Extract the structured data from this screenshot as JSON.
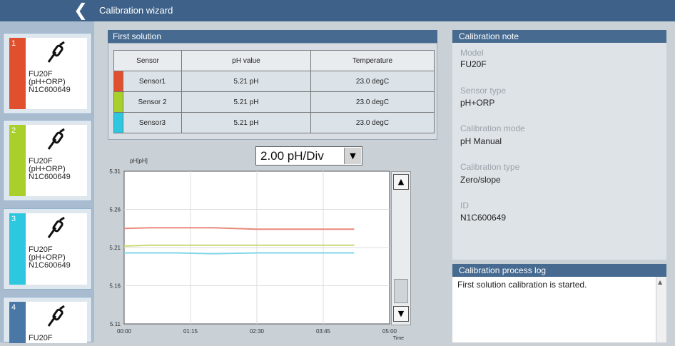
{
  "header": {
    "back_icon": "chevron-left-icon",
    "title": "Calibration wizard"
  },
  "sidebar": {
    "items": [
      {
        "number": "1",
        "color": "#e0502f",
        "line1": "FU20F",
        "line2": "(pH+ORP)",
        "line3": "N1C600649",
        "icon": "probe-icon"
      },
      {
        "number": "2",
        "color": "#a9cf2a",
        "line1": "FU20F",
        "line2": "(pH+ORP)",
        "line3": "N1C600649",
        "icon": "probe-icon"
      },
      {
        "number": "3",
        "color": "#2ec7e0",
        "line1": "FU20F",
        "line2": "(pH+ORP)",
        "line3": "N1C600649",
        "icon": "probe-icon"
      },
      {
        "number": "4",
        "color": "#4a78a6",
        "line1": "FU20F",
        "line2": "",
        "line3": "",
        "icon": "probe-icon"
      }
    ]
  },
  "first_solution": {
    "title": "First solution",
    "columns": [
      "Sensor",
      "pH value",
      "Temperature"
    ],
    "rows": [
      {
        "color": "#e0502f",
        "sensor": "Sensor1",
        "ph": "5.21 pH",
        "temp": "23.0 degC"
      },
      {
        "color": "#a9cf2a",
        "sensor": "Sensor 2",
        "ph": "5.21 pH",
        "temp": "23.0 degC"
      },
      {
        "color": "#2ec7e0",
        "sensor": "Sensor3",
        "ph": "5.21 pH",
        "temp": "23.0 degC"
      }
    ]
  },
  "scale_select": {
    "value": "2.00 pH/Div"
  },
  "chart_data": {
    "type": "line",
    "ylabel": "pH[pH]",
    "xlabel": "Time",
    "y_ticks": [
      "5.31",
      "5.26",
      "5.21",
      "5.16",
      "5.11"
    ],
    "x_ticks": [
      "00:00",
      "01:15",
      "02:30",
      "03:45",
      "05:00"
    ],
    "ylim": [
      5.11,
      5.31
    ],
    "xlim": [
      0,
      300
    ],
    "grid": true,
    "series": [
      {
        "color": "#e88a7a",
        "x": [
          0,
          30,
          60,
          100,
          150,
          200,
          250,
          260
        ],
        "y": [
          5.235,
          5.236,
          5.236,
          5.236,
          5.234,
          5.234,
          5.234,
          5.234
        ]
      },
      {
        "color": "#c9da74",
        "x": [
          0,
          30,
          60,
          100,
          150,
          200,
          250,
          260
        ],
        "y": [
          5.212,
          5.213,
          5.213,
          5.213,
          5.213,
          5.213,
          5.213,
          5.213
        ]
      },
      {
        "color": "#7fd6e8",
        "x": [
          0,
          30,
          60,
          100,
          150,
          200,
          250,
          260
        ],
        "y": [
          5.203,
          5.203,
          5.203,
          5.202,
          5.203,
          5.203,
          5.203,
          5.203
        ]
      }
    ]
  },
  "note": {
    "title": "Calibration note",
    "fields": [
      {
        "label": "Model",
        "value": "FU20F"
      },
      {
        "label": "Sensor type",
        "value": "pH+ORP"
      },
      {
        "label": "Calibration mode",
        "value": "pH Manual"
      },
      {
        "label": "Calibration type",
        "value": "Zero/slope"
      },
      {
        "label": "ID",
        "value": "N1C600649"
      }
    ]
  },
  "log": {
    "title": "Calibration process log",
    "text": "First solution calibration is started."
  }
}
